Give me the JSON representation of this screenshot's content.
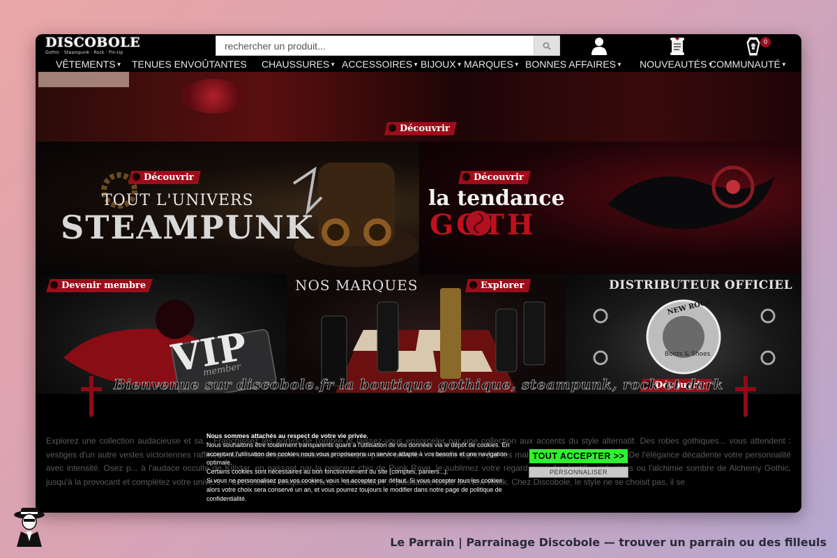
{
  "header": {
    "logo_title": "DISCOBOLE",
    "logo_subtitle": "Gothic · Steampunk · Rock · Pin-Up",
    "search_placeholder": "rechercher un produit...",
    "cart_count": "0"
  },
  "nav": {
    "items": [
      {
        "label": "VÊTEMENTS"
      },
      {
        "label": "TENUES ENVOÛTANTES"
      },
      {
        "label": "CHAUSSURES"
      },
      {
        "label": "ACCESSOIRES"
      },
      {
        "label": "BIJOUX"
      },
      {
        "label": "MARQUES"
      },
      {
        "label": "BONNES AFFAIRES"
      },
      {
        "label": "NOUVEAUTÉS"
      },
      {
        "label": "COMMUNAUTÉ"
      }
    ]
  },
  "hero": {
    "top_center_button": "Découvrir",
    "steampunk_button": "Découvrir",
    "steampunk_title_line1": "TOUT L'UNIVERS",
    "steampunk_title_line2": "STEAMPUNK",
    "goth_button": "Découvrir",
    "goth_title_line1": "la tendance",
    "goth_title_line2": "GOTH",
    "vip_button": "Devenir membre",
    "vip_text": "VIP",
    "vip_subtext": "member",
    "brands_title": "NOS MARQUES",
    "brands_button": "Explorer",
    "distributor_title": "DISTRIBUTEUR OFFICIEL",
    "newrock_line1": "NEW ROCK",
    "newrock_line2": "Boots & Shoes",
    "distributor_button": "Découvrir"
  },
  "welcome": {
    "title": "Bienvenue sur discobole.fr la boutique gothique, steampunk, rock et dark"
  },
  "body_text": "Explorez une collection audacieuse et sa... Franchissez les portes de l'ombre et laissez-vous ensorceler par une collection aux accents du style alternatif. Des robes gothiques... vous attendent : vestiges d'un autre vestes victoriennes raffinées aux ... steampunk audacieux, chaque pièce affirme ... monde signés par les maisons ... l'univers alternatif. De l'élégance décadente votre personnalité avec intensité. Osez p... à l'audace occulte de Killstar, en passant par la noirceur chic de Punk Rave, le sublimez votre regard avec des lentill... industries ou l'alchimie sombre de Alchemy Gothic, jusqu'à la provocant et complétez votre univers ... accessoires uniques et une ... décoration ... puissance brute de New Rock. Chez Discobole, le style ne se choisit pas, il se",
  "cookie": {
    "title": "Nous sommes attachés au respect de votre vie privée.",
    "line1": "Nous souhaitons être totalement transparents quant à l'utilisation de vos données via le dépôt de cookies. En acceptant l'utilisation des cookies nous vous proposerons un service adapté à vos besoins et une navigation optimale.",
    "line2": "Certains cookies sont nécessaires au bon fonctionnement du site (comptes, paniers...).",
    "line3": "Si vous ne personnalisez pas vos cookies, vous les acceptez par défaut. Si vous accepter tous les cookies alors votre choix sera conservé un an, et vous pourrez toujours le modifier dans notre page de politique de confidentialité.",
    "accept_label": "TOUT ACCEPTER >>",
    "customize_label": "PERSONNALISER"
  },
  "footer": {
    "caption": "Le Parrain | Parrainage Discobole — trouver un parrain ou des filleuls"
  },
  "colors": {
    "accent_red": "#9b0d1a",
    "accept_green": "#2ff22f",
    "page_background": "#000000"
  }
}
